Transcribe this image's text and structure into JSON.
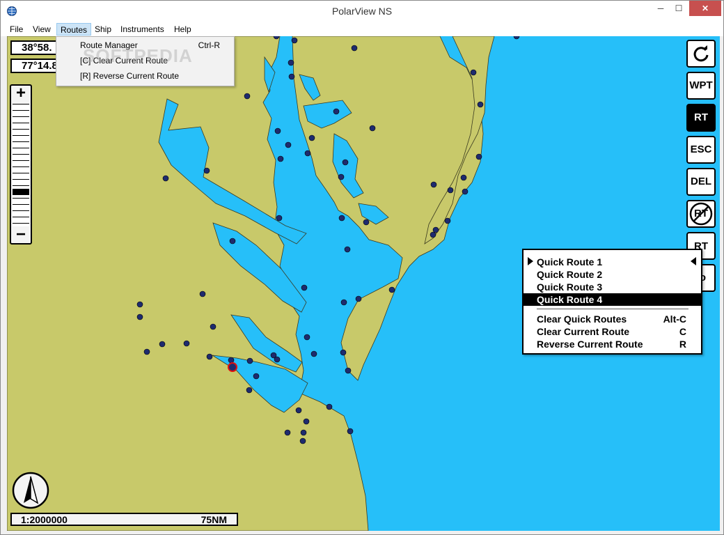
{
  "window": {
    "title": "PolarView NS",
    "min_label": "─",
    "max_label": "☐",
    "close_label": "✕"
  },
  "menubar": [
    "File",
    "View",
    "Routes",
    "Ship",
    "Instruments",
    "Help"
  ],
  "coords": {
    "lat": "38°58.",
    "lon": "77°14.8"
  },
  "zoom": {
    "plus": "+",
    "minus": "−"
  },
  "toolbar": [
    "WPT",
    "RT",
    "ESC",
    "DEL",
    "RT",
    "RT",
    "fo"
  ],
  "routes_menu": [
    {
      "label": "Route Manager",
      "shortcut": "Ctrl-R"
    },
    {
      "label": "[C] Clear Current Route",
      "shortcut": ""
    },
    {
      "label": "[R] Reverse Current Route",
      "shortcut": ""
    }
  ],
  "watermark": "SOFTPEDIA",
  "context_menu": {
    "quick_routes": [
      "Quick Route 1",
      "Quick Route 2",
      "Quick Route 3",
      "Quick Route 4"
    ],
    "selected_index": 3,
    "actions": [
      {
        "label": "Clear Quick Routes",
        "shortcut": "Alt-C"
      },
      {
        "label": "Clear Current Route",
        "shortcut": "C"
      },
      {
        "label": "Reverse Current Route",
        "shortcut": "R"
      }
    ]
  },
  "scale": {
    "ratio": "1:2000000",
    "distance": "75NM"
  },
  "colors": {
    "water": "#26bff9",
    "land": "#c8c96a",
    "marker": "#1e2b6e"
  }
}
